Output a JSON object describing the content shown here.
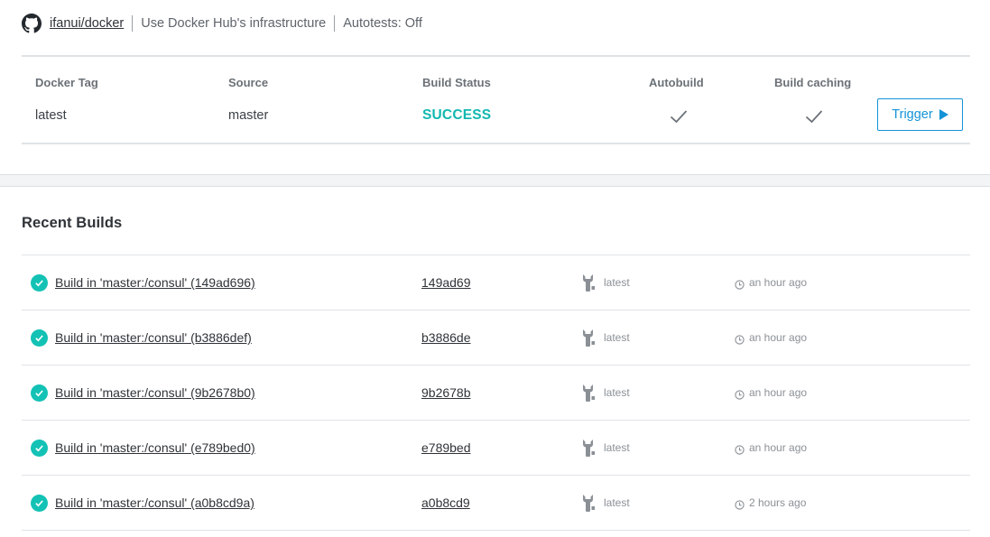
{
  "header": {
    "repo": "ifanui/docker",
    "infrastructure": "Use Docker Hub's infrastructure",
    "autotests": "Autotests: Off"
  },
  "config": {
    "columns": [
      "Docker Tag",
      "Source",
      "Build Status",
      "Autobuild",
      "Build caching"
    ],
    "docker_tag": "latest",
    "source": "master",
    "build_status": "SUCCESS",
    "autobuild_enabled": true,
    "build_caching_enabled": true,
    "trigger_label": "Trigger"
  },
  "recent": {
    "title": "Recent Builds",
    "builds": [
      {
        "name": "Build in 'master:/consul' (149ad696)",
        "commit": "149ad69",
        "tag": "latest",
        "time": "an hour ago"
      },
      {
        "name": "Build in 'master:/consul' (b3886def)",
        "commit": "b3886de",
        "tag": "latest",
        "time": "an hour ago"
      },
      {
        "name": "Build in 'master:/consul' (9b2678b0)",
        "commit": "9b2678b",
        "tag": "latest",
        "time": "an hour ago"
      },
      {
        "name": "Build in 'master:/consul' (e789bed0)",
        "commit": "e789bed",
        "tag": "latest",
        "time": "an hour ago"
      },
      {
        "name": "Build in 'master:/consul' (a0b8cd9a)",
        "commit": "a0b8cd9",
        "tag": "latest",
        "time": "2 hours ago"
      }
    ]
  },
  "colors": {
    "success": "#12b8b0",
    "accent": "#1593d6"
  },
  "icons": [
    "github-icon",
    "checkmark-icon",
    "play-icon",
    "success-check-icon",
    "wrench-icon",
    "clock-icon"
  ]
}
